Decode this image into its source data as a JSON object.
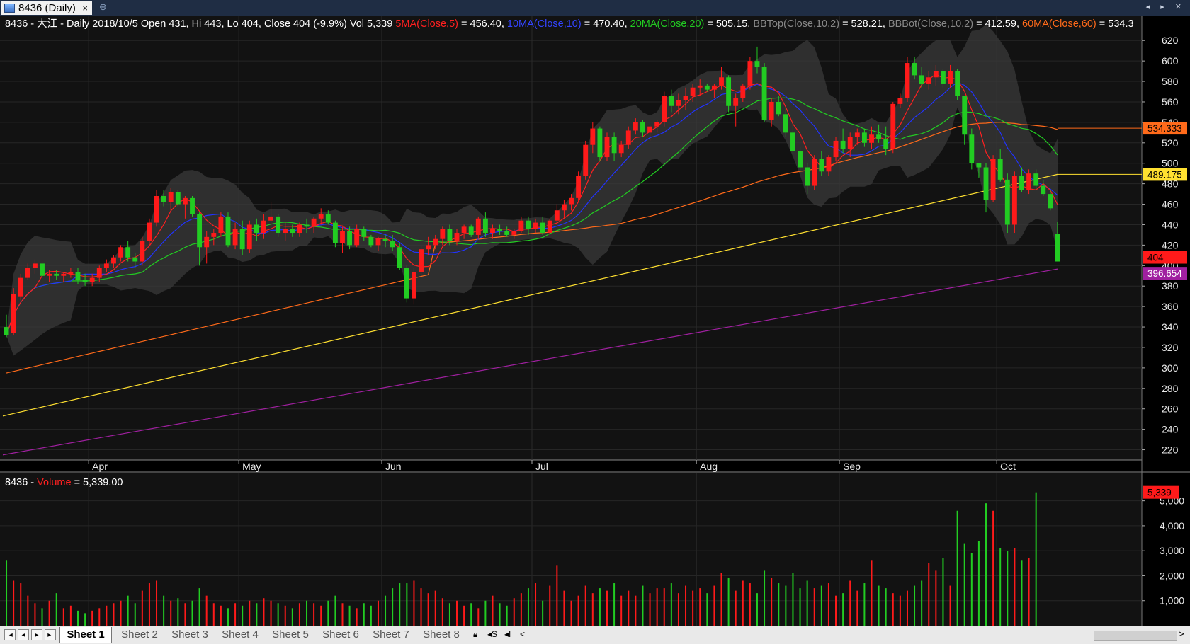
{
  "window": {
    "tab_label": "8436 (Daily)",
    "tab_close": "×",
    "tab_add": "⊕",
    "right_controls": "◂ ▸ ✕"
  },
  "price_header": {
    "symbol_info": "8436 - 大江  - Daily 2018/10/5 Open 431, Hi 443, Lo 404, Close 404 (-9.9%) Vol 5,339",
    "ma5_label": "5MA(Close,5)",
    "ma5_value": "= 456.40,",
    "ma10_label": "10MA(Close,10)",
    "ma10_value": "= 470.40,",
    "ma20_label": "20MA(Close,20)",
    "ma20_value": "= 505.15,",
    "bbtop_label": "BBTop(Close,10,2)",
    "bbtop_value": "= 528.21,",
    "bbbot_label": "BBBot(Close,10,2)",
    "bbbot_value": "= 412.59,",
    "ma60_label": "60MA(Close,60)",
    "ma60_value": "= 534.3"
  },
  "volume_header": {
    "symbol": "8436 -",
    "label": "Volume",
    "value": "= 5,339.00"
  },
  "price_axis": {
    "ticks": [
      "620",
      "600",
      "580",
      "560",
      "540",
      "520",
      "500",
      "480",
      "460",
      "440",
      "420",
      "400",
      "380",
      "360",
      "340",
      "320",
      "300",
      "280",
      "260",
      "240",
      "220"
    ],
    "badges": [
      {
        "text": "534.333",
        "value": 534.333,
        "color": "#ff6a1a"
      },
      {
        "text": "489.175",
        "value": 489.175,
        "color": "#ffe030"
      },
      {
        "text": "404",
        "value": 404,
        "color": "#ff1a1a"
      },
      {
        "text": "396.654",
        "value": 396.654,
        "color": "#a020a0"
      }
    ]
  },
  "volume_axis": {
    "ticks": [
      "5,000",
      "4,000",
      "3,000",
      "2,000",
      "1,000"
    ],
    "badge": "5,339"
  },
  "month_labels": [
    "Apr",
    "May",
    "Jun",
    "Jul",
    "Aug",
    "Sep",
    "Oct"
  ],
  "statusbar": {
    "sheets": [
      "Sheet 1",
      "Sheet 2",
      "Sheet 3",
      "Sheet 4",
      "Sheet 5",
      "Sheet 6",
      "Sheet 7",
      "Sheet 8"
    ],
    "active_sheet": "Sheet 1",
    "nav": [
      "|◂",
      "◂",
      "▸",
      "▸|"
    ]
  },
  "colors": {
    "up": "#ff1a1a",
    "down": "#22cc22",
    "ma5": "#ff2020",
    "ma10": "#2233ff",
    "ma20": "#22cc22",
    "ma60": "#ff6a1a",
    "ma_long": "#ffe030",
    "ma_longest": "#a020a0",
    "band": "#3a3a3a"
  },
  "chart_data": {
    "type": "candlestick",
    "symbol": "8436 大江",
    "date": "2018/10/5",
    "open": 431,
    "high": 443,
    "low": 404,
    "close": 404,
    "change_pct": -9.9,
    "volume": [
      2600,
      1800,
      1700,
      1200,
      900,
      700,
      1000,
      1300,
      700,
      800,
      600,
      500,
      600,
      700,
      800,
      900,
      1000,
      1200,
      900,
      1400,
      1700,
      1800,
      1200,
      1000,
      1100,
      900,
      1000,
      1500,
      1200,
      900,
      800,
      700,
      900,
      800,
      1000,
      900,
      1100,
      1000,
      900,
      800,
      700,
      900,
      1000,
      900,
      800,
      1000,
      1200,
      900,
      800,
      700,
      900,
      800,
      1000,
      1200,
      1500,
      1700,
      1700,
      1800,
      1500,
      1300,
      1400,
      1100,
      900,
      1000,
      800,
      900,
      700,
      1000,
      1200,
      900,
      800,
      1100,
      1300,
      1500,
      1700,
      1000,
      1600,
      2400,
      1400,
      1000,
      1200,
      1600,
      1300,
      1500,
      1400,
      1700,
      1200,
      1400,
      1200,
      1600,
      1300,
      1500,
      1500,
      1700,
      1300,
      1600,
      1400,
      1500,
      1300,
      1600,
      2100,
      1900,
      1400,
      1800,
      1700,
      1300,
      2200,
      1900,
      1700,
      1600,
      2100,
      1500,
      1800,
      1500,
      1600,
      1700,
      1200,
      1300,
      1800,
      1400,
      1700,
      2600,
      1600,
      1500,
      1300,
      1200,
      1400,
      1600,
      1800,
      2500,
      2200,
      2700,
      1600,
      4600,
      3300,
      2900,
      3400,
      4900,
      4600,
      3100,
      3000,
      3100,
      2600,
      2700,
      5339
    ],
    "indicators": {
      "5MA": 456.4,
      "10MA": 470.4,
      "20MA": 505.15,
      "BBTop": 528.21,
      "BBBot": 412.59,
      "60MA": 534.3
    },
    "price_ylim": [
      210,
      625
    ],
    "volume_ylim": [
      0,
      5500
    ],
    "ohlc": [
      [
        340,
        352,
        330,
        332
      ],
      [
        334,
        378,
        332,
        372
      ],
      [
        370,
        392,
        366,
        388
      ],
      [
        388,
        402,
        386,
        398
      ],
      [
        398,
        406,
        392,
        402
      ],
      [
        402,
        404,
        384,
        390
      ],
      [
        390,
        396,
        384,
        392
      ],
      [
        392,
        396,
        386,
        390
      ],
      [
        390,
        394,
        384,
        392
      ],
      [
        392,
        398,
        388,
        394
      ],
      [
        394,
        398,
        382,
        386
      ],
      [
        386,
        392,
        380,
        384
      ],
      [
        384,
        392,
        380,
        388
      ],
      [
        388,
        400,
        384,
        398
      ],
      [
        398,
        406,
        394,
        402
      ],
      [
        402,
        410,
        398,
        408
      ],
      [
        408,
        420,
        404,
        418
      ],
      [
        418,
        424,
        404,
        408
      ],
      [
        408,
        412,
        398,
        404
      ],
      [
        404,
        428,
        400,
        424
      ],
      [
        424,
        446,
        420,
        442
      ],
      [
        442,
        474,
        438,
        468
      ],
      [
        468,
        474,
        458,
        462
      ],
      [
        462,
        476,
        454,
        472
      ],
      [
        472,
        474,
        458,
        460
      ],
      [
        460,
        468,
        446,
        466
      ],
      [
        466,
        468,
        448,
        450
      ],
      [
        450,
        452,
        400,
        418
      ],
      [
        418,
        434,
        402,
        428
      ],
      [
        428,
        436,
        420,
        432
      ],
      [
        432,
        452,
        428,
        448
      ],
      [
        448,
        452,
        418,
        420
      ],
      [
        420,
        442,
        416,
        436
      ],
      [
        436,
        444,
        410,
        416
      ],
      [
        416,
        444,
        412,
        440
      ],
      [
        440,
        446,
        424,
        432
      ],
      [
        432,
        450,
        426,
        444
      ],
      [
        444,
        462,
        436,
        448
      ],
      [
        448,
        450,
        428,
        432
      ],
      [
        432,
        442,
        424,
        436
      ],
      [
        436,
        440,
        428,
        432
      ],
      [
        432,
        442,
        428,
        440
      ],
      [
        440,
        446,
        432,
        438
      ],
      [
        438,
        448,
        432,
        446
      ],
      [
        446,
        456,
        440,
        450
      ],
      [
        450,
        454,
        440,
        442
      ],
      [
        442,
        444,
        418,
        422
      ],
      [
        422,
        438,
        412,
        434
      ],
      [
        434,
        438,
        416,
        420
      ],
      [
        420,
        440,
        418,
        436
      ],
      [
        436,
        438,
        424,
        428
      ],
      [
        428,
        430,
        418,
        420
      ],
      [
        420,
        428,
        414,
        426
      ],
      [
        426,
        430,
        418,
        424
      ],
      [
        424,
        430,
        414,
        418
      ],
      [
        418,
        422,
        396,
        398
      ],
      [
        398,
        400,
        364,
        368
      ],
      [
        368,
        398,
        362,
        394
      ],
      [
        394,
        420,
        390,
        416
      ],
      [
        416,
        428,
        410,
        420
      ],
      [
        420,
        430,
        416,
        426
      ],
      [
        426,
        438,
        420,
        436
      ],
      [
        436,
        440,
        420,
        424
      ],
      [
        424,
        436,
        420,
        432
      ],
      [
        432,
        440,
        426,
        438
      ],
      [
        438,
        440,
        428,
        430
      ],
      [
        430,
        448,
        426,
        446
      ],
      [
        446,
        452,
        428,
        432
      ],
      [
        432,
        440,
        426,
        436
      ],
      [
        436,
        440,
        430,
        434
      ],
      [
        434,
        438,
        428,
        430
      ],
      [
        430,
        436,
        426,
        434
      ],
      [
        434,
        448,
        432,
        444
      ],
      [
        444,
        448,
        430,
        436
      ],
      [
        436,
        446,
        432,
        442
      ],
      [
        442,
        448,
        430,
        432
      ],
      [
        432,
        446,
        430,
        444
      ],
      [
        444,
        460,
        440,
        454
      ],
      [
        454,
        464,
        446,
        460
      ],
      [
        460,
        470,
        454,
        466
      ],
      [
        466,
        492,
        462,
        488
      ],
      [
        488,
        522,
        484,
        518
      ],
      [
        518,
        540,
        510,
        534
      ],
      [
        534,
        536,
        502,
        506
      ],
      [
        506,
        530,
        502,
        526
      ],
      [
        526,
        530,
        502,
        510
      ],
      [
        510,
        522,
        506,
        518
      ],
      [
        518,
        536,
        514,
        532
      ],
      [
        532,
        544,
        528,
        540
      ],
      [
        540,
        542,
        526,
        530
      ],
      [
        530,
        538,
        522,
        536
      ],
      [
        536,
        542,
        530,
        540
      ],
      [
        540,
        570,
        536,
        566
      ],
      [
        566,
        572,
        550,
        556
      ],
      [
        556,
        568,
        548,
        562
      ],
      [
        562,
        574,
        552,
        566
      ],
      [
        566,
        578,
        560,
        574
      ],
      [
        574,
        582,
        566,
        576
      ],
      [
        576,
        578,
        570,
        572
      ],
      [
        572,
        578,
        564,
        576
      ],
      [
        576,
        594,
        572,
        584
      ],
      [
        584,
        586,
        550,
        556
      ],
      [
        556,
        568,
        536,
        564
      ],
      [
        564,
        578,
        560,
        576
      ],
      [
        576,
        604,
        572,
        600
      ],
      [
        600,
        614,
        588,
        594
      ],
      [
        594,
        598,
        540,
        542
      ],
      [
        542,
        564,
        536,
        560
      ],
      [
        560,
        566,
        546,
        548
      ],
      [
        548,
        554,
        526,
        530
      ],
      [
        530,
        544,
        506,
        512
      ],
      [
        512,
        516,
        490,
        496
      ],
      [
        496,
        500,
        470,
        478
      ],
      [
        478,
        508,
        474,
        504
      ],
      [
        504,
        512,
        488,
        492
      ],
      [
        492,
        508,
        488,
        506
      ],
      [
        506,
        526,
        502,
        522
      ],
      [
        522,
        534,
        510,
        514
      ],
      [
        514,
        530,
        506,
        526
      ],
      [
        526,
        534,
        518,
        530
      ],
      [
        530,
        534,
        516,
        520
      ],
      [
        520,
        536,
        514,
        528
      ],
      [
        528,
        538,
        520,
        524
      ],
      [
        524,
        536,
        508,
        514
      ],
      [
        514,
        560,
        510,
        558
      ],
      [
        558,
        568,
        554,
        564
      ],
      [
        564,
        604,
        560,
        598
      ],
      [
        598,
        604,
        582,
        586
      ],
      [
        586,
        594,
        574,
        578
      ],
      [
        578,
        590,
        572,
        584
      ],
      [
        584,
        596,
        576,
        590
      ],
      [
        590,
        592,
        574,
        578
      ],
      [
        578,
        596,
        574,
        590
      ],
      [
        590,
        592,
        562,
        566
      ],
      [
        566,
        566,
        518,
        528
      ],
      [
        528,
        534,
        494,
        500
      ],
      [
        500,
        500,
        486,
        496
      ],
      [
        496,
        500,
        452,
        464
      ],
      [
        464,
        508,
        462,
        504
      ],
      [
        504,
        514,
        482,
        484
      ],
      [
        484,
        490,
        432,
        440
      ],
      [
        440,
        492,
        432,
        488
      ],
      [
        488,
        496,
        472,
        474
      ],
      [
        474,
        494,
        470,
        490
      ],
      [
        490,
        494,
        474,
        478
      ],
      [
        478,
        484,
        468,
        470
      ],
      [
        470,
        474,
        454,
        456
      ],
      [
        431,
        443,
        404,
        404
      ]
    ],
    "months": [
      "Apr",
      "May",
      "Jun",
      "Jul",
      "Aug",
      "Sep",
      "Oct"
    ]
  }
}
